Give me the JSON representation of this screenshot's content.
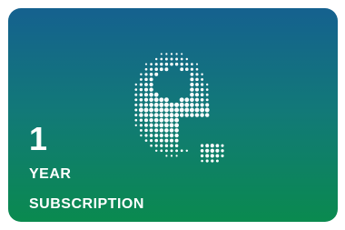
{
  "card": {
    "duration": "1",
    "unit": "YEAR",
    "label": "SUBSCRIPTION",
    "logo_icon": "halftone-letter-e-icon",
    "colors": {
      "gradient_top": "#15618f",
      "gradient_mid": "#127978",
      "gradient_bottom": "#0a8a4f",
      "text": "#ffffff",
      "dots": "#ffffff"
    }
  }
}
